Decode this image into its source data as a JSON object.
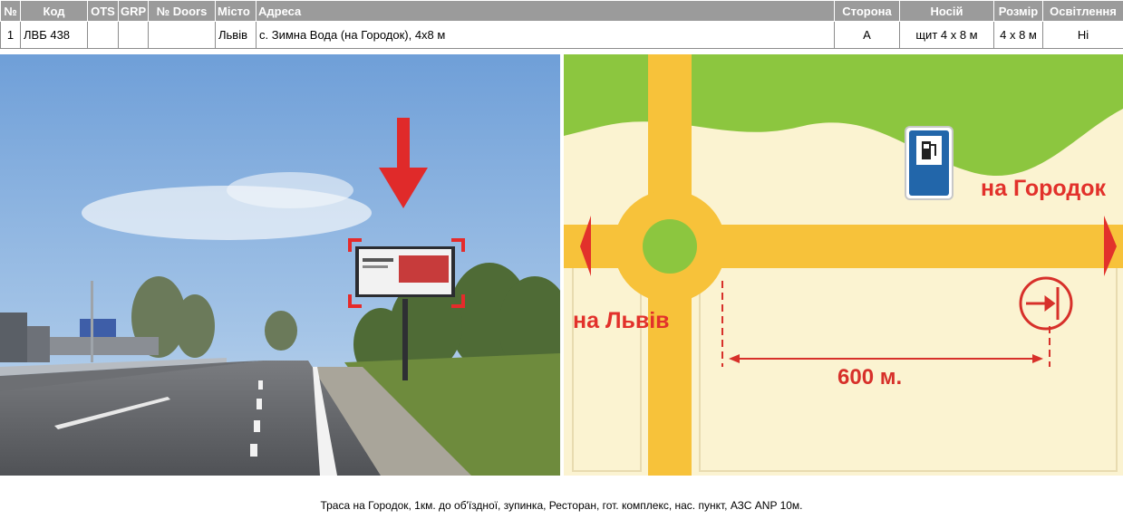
{
  "table": {
    "headers": [
      "№",
      "Код",
      "OTS",
      "GRP",
      "№ Doors",
      "Місто",
      "Адреса",
      "Сторона",
      "Носій",
      "Розмір",
      "Освітлення"
    ],
    "row": {
      "num": "1",
      "code": "ЛВБ 438",
      "ots": "",
      "grp": "",
      "doors": "",
      "city": "Львів",
      "address": "с. Зимна Вода (на Городок), 4x8 м",
      "side": "A",
      "carrier": "щит 4 x 8 м",
      "size": "4 x 8 м",
      "lighting": "Ні"
    }
  },
  "map": {
    "label_gorodok": "на Городок",
    "label_lviv": "на Львів",
    "distance": "600 м."
  },
  "colors": {
    "road": "#f7c23a",
    "field": "#fbf3d1",
    "forest": "#8cc63f",
    "accent_red": "#e2312b"
  },
  "caption": "Траса на Городок, 1км. до об'їздної, зупинка, Ресторан, гот. комплекс, нас. пункт, АЗС ANP 10м."
}
